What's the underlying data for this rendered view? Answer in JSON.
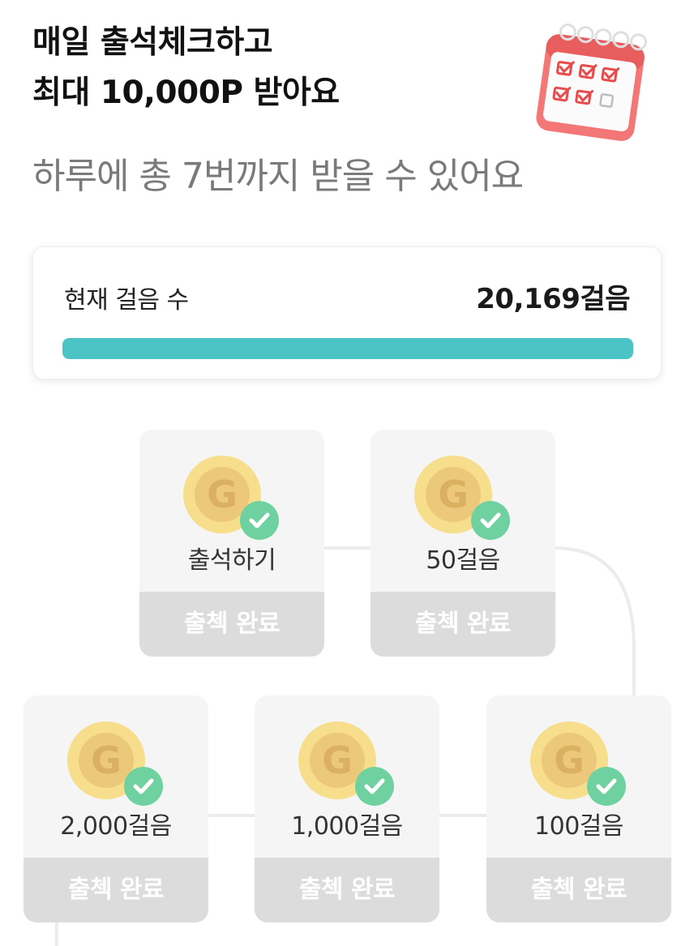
{
  "header": {
    "headline_line1": "매일 출석체크하고",
    "headline_line2": "최대 10,000P 받아요",
    "subtitle": "하루에 총 7번까지 받을 수 있어요",
    "icon": "calendar-checklist-icon"
  },
  "steps": {
    "label": "현재 걸음 수",
    "value": "20,169걸음",
    "progress_percent": 100,
    "progress_color": "#4cc3c5"
  },
  "stamps": [
    {
      "label": "출석하기",
      "status": "출첵 완료",
      "completed": true
    },
    {
      "label": "50걸음",
      "status": "출첵 완료",
      "completed": true
    },
    {
      "label": "100걸음",
      "status": "출첵 완료",
      "completed": true
    },
    {
      "label": "1,000걸음",
      "status": "출첵 완료",
      "completed": true
    },
    {
      "label": "2,000걸음",
      "status": "출첵 완료",
      "completed": true
    }
  ],
  "colors": {
    "coin_outer": "#f7de8c",
    "coin_inner": "#e8c678",
    "check_badge": "#6fd0a0",
    "status_bg": "#dcdcdc"
  }
}
